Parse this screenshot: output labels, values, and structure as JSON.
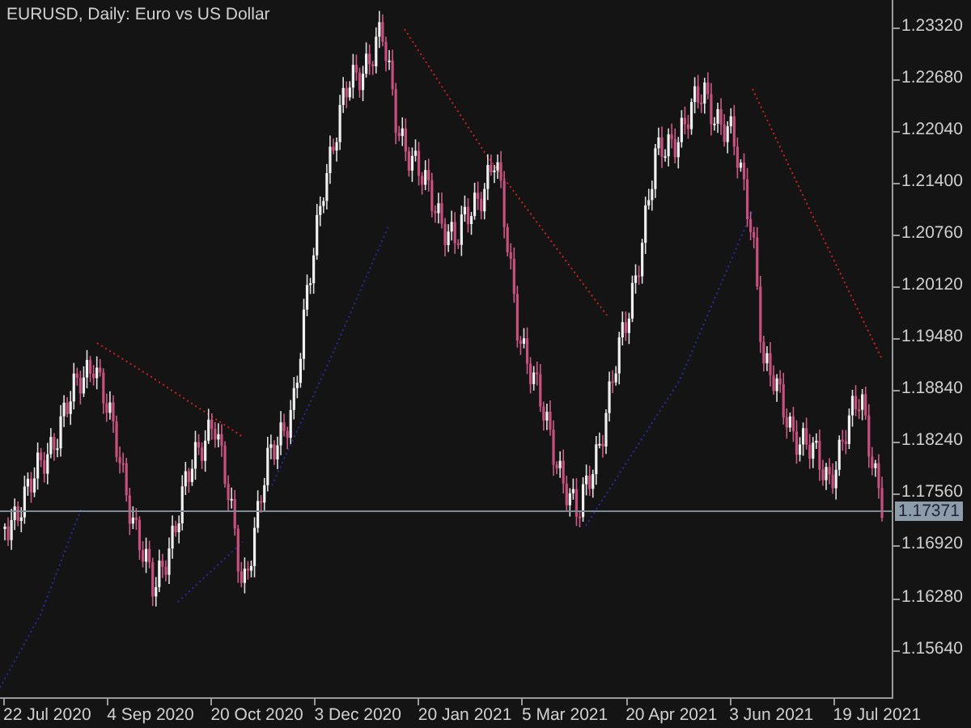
{
  "chart_title": "EURUSD, Daily:  Euro vs US Dollar",
  "price_axis": [
    "1.23320",
    "1.22680",
    "1.22040",
    "1.21400",
    "1.20760",
    "1.20120",
    "1.19480",
    "1.18840",
    "1.18240",
    "1.17560",
    "1.16920",
    "1.16280",
    "1.15640"
  ],
  "current_price": "1.17371",
  "time_axis": [
    "22 Jul 2020",
    "4 Sep 2020",
    "20 Oct 2020",
    "3 Dec 2020",
    "20 Jan 2021",
    "5 Mar 2021",
    "20 Apr 2021",
    "3 Jun 2021",
    "19 Jul 2021"
  ]
}
